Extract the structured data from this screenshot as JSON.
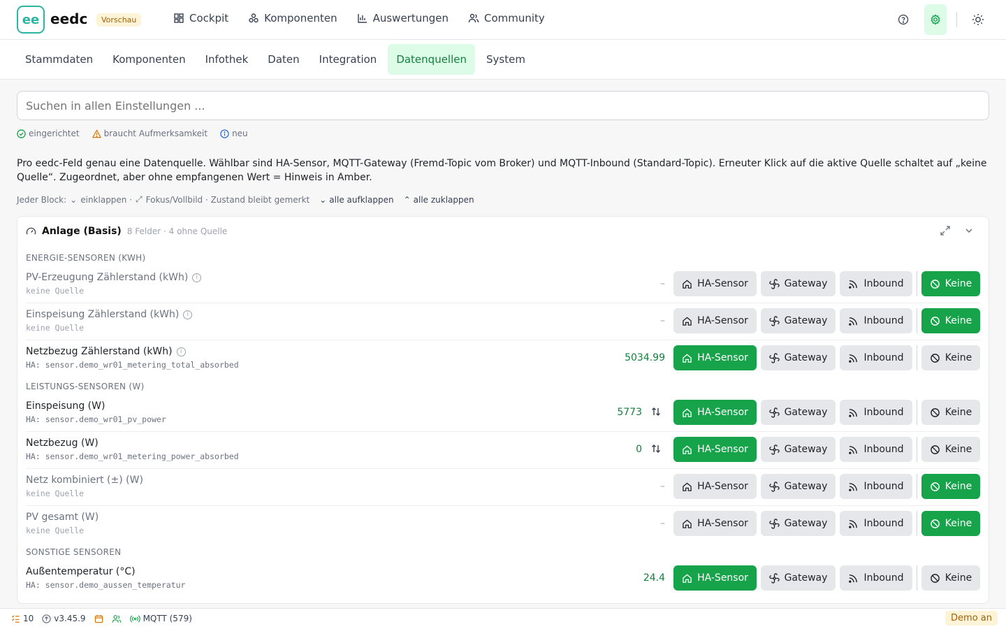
{
  "app": {
    "logo_text": "ee",
    "brand": "eedc",
    "badge": "Vorschau"
  },
  "nav": [
    {
      "label": "Cockpit",
      "icon": "grid-icon"
    },
    {
      "label": "Komponenten",
      "icon": "components-icon"
    },
    {
      "label": "Auswertungen",
      "icon": "bar-chart-icon"
    },
    {
      "label": "Community",
      "icon": "users-icon"
    }
  ],
  "tabs": [
    "Stammdaten",
    "Komponenten",
    "Infothek",
    "Daten",
    "Integration",
    "Datenquellen",
    "System"
  ],
  "active_tab": "Datenquellen",
  "search": {
    "placeholder": "Suchen in allen Einstellungen ..."
  },
  "legend": {
    "ok": "eingerichtet",
    "warn": "braucht Aufmerksamkeit",
    "new": "neu"
  },
  "description": "Pro eedc-Feld genau eine Datenquelle. Wählbar sind HA-Sensor, MQTT-Gateway (Fremd-Topic vom Broker) und MQTT-Inbound (Standard-Topic). Erneuter Klick auf die aktive Quelle schaltet auf „keine Quelle“. Zugeordnet, aber ohne empfangenen Wert = Hinweis in Amber.",
  "hint": {
    "prefix": "Jeder Block:",
    "collapse": "einklappen ·",
    "focus": "Fokus/Vollbild · Zustand bleibt gemerkt",
    "expand_all": "alle aufklappen",
    "collapse_all": "alle zuklappen"
  },
  "card": {
    "title": "Anlage (Basis)",
    "meta": "8 Felder · 4 ohne Quelle"
  },
  "buttons": {
    "ha": "HA-Sensor",
    "gw": "Gateway",
    "ib": "Inbound",
    "ke": "Keine"
  },
  "sections": [
    "ENERGIE-SENSOREN (KWH)",
    "LEISTUNGS-SENSOREN (W)",
    "SONSTIGE SENSOREN"
  ],
  "rows": [
    {
      "label": "PV-Erzeugung Zählerstand (kWh)",
      "source": "keine Quelle",
      "value": "–",
      "active": "ke"
    },
    {
      "label": "Einspeisung Zählerstand (kWh)",
      "source": "keine Quelle",
      "value": "–",
      "active": "ke"
    },
    {
      "label": "Netzbezug Zählerstand (kWh)",
      "source": "HA: sensor.demo_wr01_metering_total_absorbed",
      "value": "5034.99",
      "active": "ha"
    },
    {
      "label": "Einspeisung (W)",
      "source": "HA: sensor.demo_wr01_pv_power",
      "value": "5773",
      "active": "ha"
    },
    {
      "label": "Netzbezug (W)",
      "source": "HA: sensor.demo_wr01_metering_power_absorbed",
      "value": "0",
      "active": "ha"
    },
    {
      "label": "Netz kombiniert (±) (W)",
      "source": "keine Quelle",
      "value": "–",
      "active": "ke"
    },
    {
      "label": "PV gesamt (W)",
      "source": "keine Quelle",
      "value": "–",
      "active": "ke"
    },
    {
      "label": "Außentemperatur (°C)",
      "source": "HA: sensor.demo_aussen_temperatur",
      "value": "24.4",
      "active": "ha"
    }
  ],
  "footer": {
    "count": "10",
    "version": "v3.45.9",
    "mqtt": "MQTT (579)",
    "demo": "Demo an"
  },
  "colors": {
    "accent": "#16a34a",
    "accent_bg": "#dcfce7",
    "brand": "#2bb5a5",
    "amber": "#a16207"
  }
}
